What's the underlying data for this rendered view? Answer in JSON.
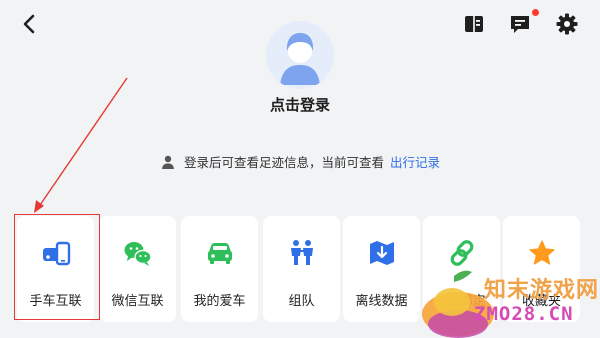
{
  "header": {
    "back_icon": "back-chevron-icon",
    "icons": [
      "book-icon",
      "message-icon",
      "gear-icon"
    ]
  },
  "profile": {
    "avatar_icon": "default-avatar-icon",
    "login_label": "点击登录"
  },
  "hint": {
    "text": "登录后可查看足迹信息，当前可查看",
    "link": "出行记录"
  },
  "cards": [
    {
      "label": "手车互联",
      "icon": "car-phone-icon",
      "color": "#2f6fe8"
    },
    {
      "label": "微信互联",
      "icon": "wechat-icon",
      "color": "#2fbf5a"
    },
    {
      "label": "我的爱车",
      "icon": "car-icon",
      "color": "#2fbf5a"
    },
    {
      "label": "组队",
      "icon": "team-icon",
      "color": "#2f6fe8"
    },
    {
      "label": "离线数据",
      "icon": "offline-map-icon",
      "color": "#2f6fe8"
    },
    {
      "label": "绑定",
      "icon": "link-icon",
      "color": "#2fbf5a"
    },
    {
      "label": "收藏夹",
      "icon": "star-icon",
      "color": "#ff9a1f"
    }
  ],
  "watermark": {
    "line1": "知末游戏网",
    "line2": "ZMO28.CN"
  },
  "colors": {
    "accent": "#2f6fe8",
    "highlight": "#e53935",
    "badge": "#ff3b30"
  }
}
